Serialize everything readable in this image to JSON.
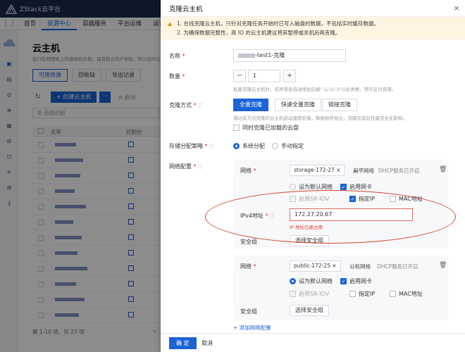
{
  "app": {
    "title": "ZStack云平台",
    "logo_text": "ZStack"
  },
  "nav": {
    "items": [
      "首页",
      "资源中心",
      "容器服务",
      "平台运维",
      "运营管理"
    ],
    "active_index": 1
  },
  "page": {
    "title": "云主机",
    "subtitle": "运行在物理机上的虚拟机实例，具有独立的IP地址，可以访问公",
    "tabs": [
      "可用资源",
      "回收站",
      "导出记录"
    ],
    "create_label": "创建云主机",
    "more_label": "···",
    "start_label": "启动",
    "search_placeholder": "自动识别",
    "col_name": "名称",
    "col_console": "控制台",
    "pager": "第 1-10 项，共 27 项",
    "pager_right": "<"
  },
  "drawer": {
    "title": "克隆云主机",
    "close": "×",
    "warnings": [
      "1. 在线克隆云主机，只针对克隆任务开始时已写入磁盘的数据，不包括实时缓存数据。",
      "2. 为确保数据完整性，高 IO 的云主机建议将其暂停或关机后再克隆。"
    ],
    "name_label": "名称",
    "name_value": "-test1-克隆",
    "count_label": "数量",
    "count_value": "1",
    "count_minus": "−",
    "count_plus": "+",
    "count_hint": "批量克隆云主机时，名称将会自动增加后缀\"-1/-2/-3\"以此类推，用于区分资源。",
    "clone_method_label": "克隆方式",
    "clone_methods": [
      "全量克隆",
      "快速全量克隆",
      "链接克隆"
    ],
    "clone_hint": "通过此方式克隆的云主机启动速度较慢，数据始终独立，克隆完成后性能完全无影响。",
    "clone_disk_label": "同时克隆已加载的云盘",
    "storage_label": "存储分配策略",
    "storage_options": [
      "系统分配",
      "手动指定"
    ],
    "net_config_label": "网络配置",
    "networks": [
      {
        "net_label": "网络",
        "net_tag": "storage-172-27",
        "net_tag_close": "×",
        "net_type": "扁平网络",
        "dhcp": "DHCP服务已开启",
        "default_net": "设为默认网络",
        "enable_nic": "启用网卡",
        "sriov": "启用SR-IOV",
        "fixed_ip": "指定IP",
        "mac": "MAC地址",
        "ipv4_label": "IPv4地址",
        "ipv4_value": "172.27.20.67",
        "ipv4_error": "IP 地址已被占用",
        "sg_label": "安全组",
        "sg_button": "选择安全组"
      },
      {
        "net_label": "网络",
        "net_tag": "public-172-25",
        "net_tag_close": "×",
        "net_type": "公有网络",
        "dhcp": "DHCP服务已开启",
        "default_net": "设为默认网络",
        "enable_nic": "启用网卡",
        "sriov": "启用SR-IOV",
        "fixed_ip": "指定IP",
        "mac": "MAC地址",
        "sg_label": "安全组",
        "sg_button": "选择安全组"
      }
    ],
    "add_network": "+ 添加网络配置",
    "ok": "确 定",
    "cancel": "取消"
  },
  "colors": {
    "primary": "#1b63d6",
    "topbar": "#1b2a4e",
    "error": "#e03a2a",
    "warning_bg": "#fdf4e2",
    "annotation": "#d5452f"
  }
}
